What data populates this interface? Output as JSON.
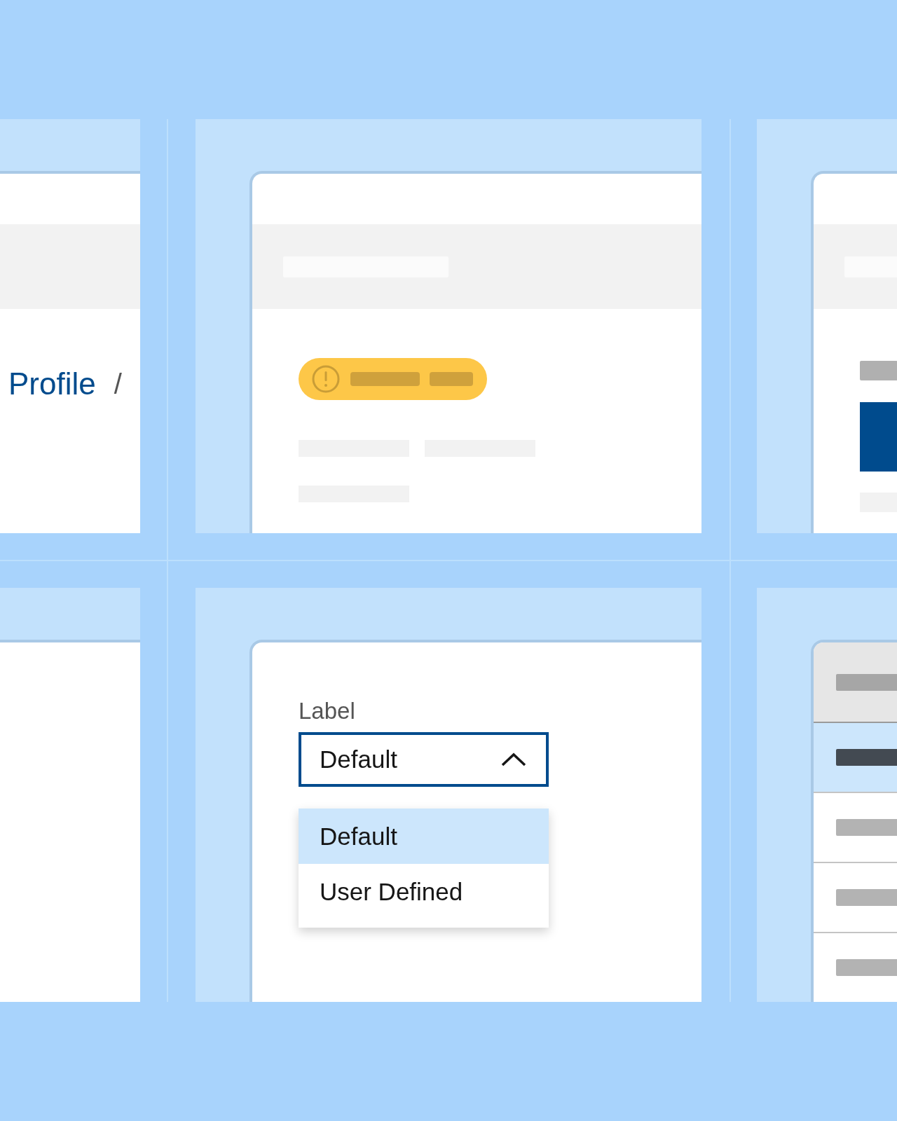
{
  "breadcrumb": {
    "items": [
      {
        "label": "Profile"
      }
    ],
    "separator": "/"
  },
  "select": {
    "label": "Label",
    "value": "Default",
    "expanded": true,
    "options": [
      {
        "label": "Default",
        "selected": true
      },
      {
        "label": "User Defined",
        "selected": false
      }
    ]
  },
  "list": {
    "rows": [
      {
        "selected": true
      },
      {
        "selected": false
      },
      {
        "selected": false
      },
      {
        "selected": false
      }
    ]
  }
}
